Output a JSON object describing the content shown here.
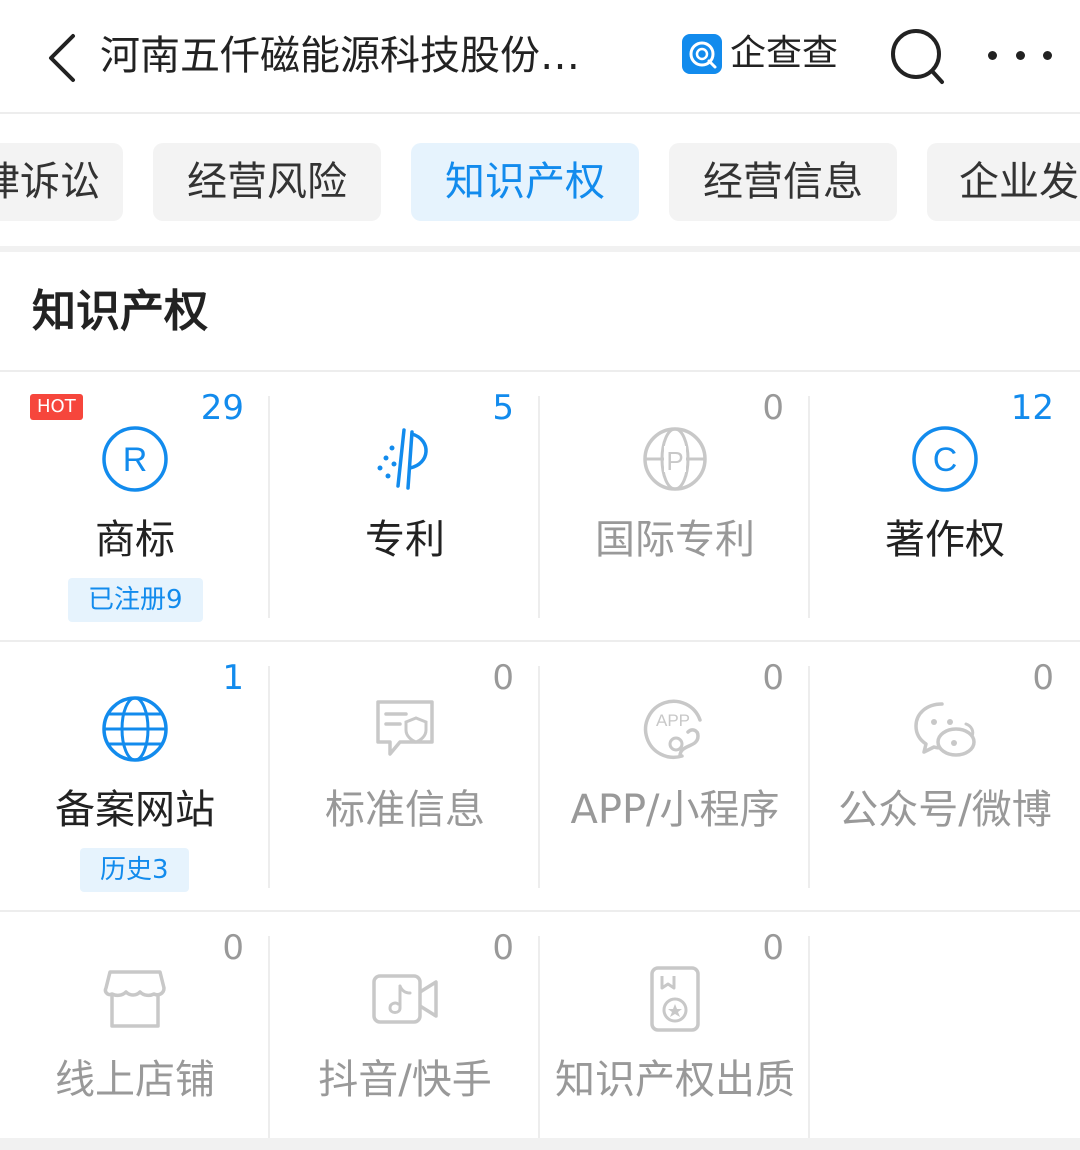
{
  "header": {
    "title": "河南五仟磁能源科技股份…",
    "brand": "企查查"
  },
  "tabs": [
    {
      "label": "律诉讼",
      "active": false
    },
    {
      "label": "经营风险",
      "active": false
    },
    {
      "label": "知识产权",
      "active": true
    },
    {
      "label": "经营信息",
      "active": false
    },
    {
      "label": "企业发",
      "active": false
    }
  ],
  "section": {
    "title": "知识产权"
  },
  "grid": {
    "items": [
      {
        "label": "商标",
        "count": "29",
        "hot": "HOT",
        "sub": "已注册9",
        "icon": "registered-icon",
        "active": true
      },
      {
        "label": "专利",
        "count": "5",
        "icon": "patent-icon",
        "active": true
      },
      {
        "label": "国际专利",
        "count": "0",
        "icon": "intl-patent-icon",
        "active": false
      },
      {
        "label": "著作权",
        "count": "12",
        "icon": "copyright-icon",
        "active": true
      },
      {
        "label": "备案网站",
        "count": "1",
        "sub": "历史3",
        "icon": "globe-icon",
        "active": true
      },
      {
        "label": "标准信息",
        "count": "0",
        "icon": "standard-icon",
        "active": false
      },
      {
        "label": "APP/小程序",
        "count": "0",
        "icon": "app-icon",
        "active": false
      },
      {
        "label": "公众号/微博",
        "count": "0",
        "icon": "weibo-icon",
        "active": false
      },
      {
        "label": "线上店铺",
        "count": "0",
        "icon": "store-icon",
        "active": false
      },
      {
        "label": "抖音/快手",
        "count": "0",
        "icon": "video-icon",
        "active": false
      },
      {
        "label": "知识产权出质",
        "count": "0",
        "icon": "pledge-icon",
        "active": false
      }
    ]
  },
  "colors": {
    "accent": "#128bed",
    "muted": "#999999",
    "hot": "#f6463c",
    "icon_muted": "#c8c8c8"
  }
}
